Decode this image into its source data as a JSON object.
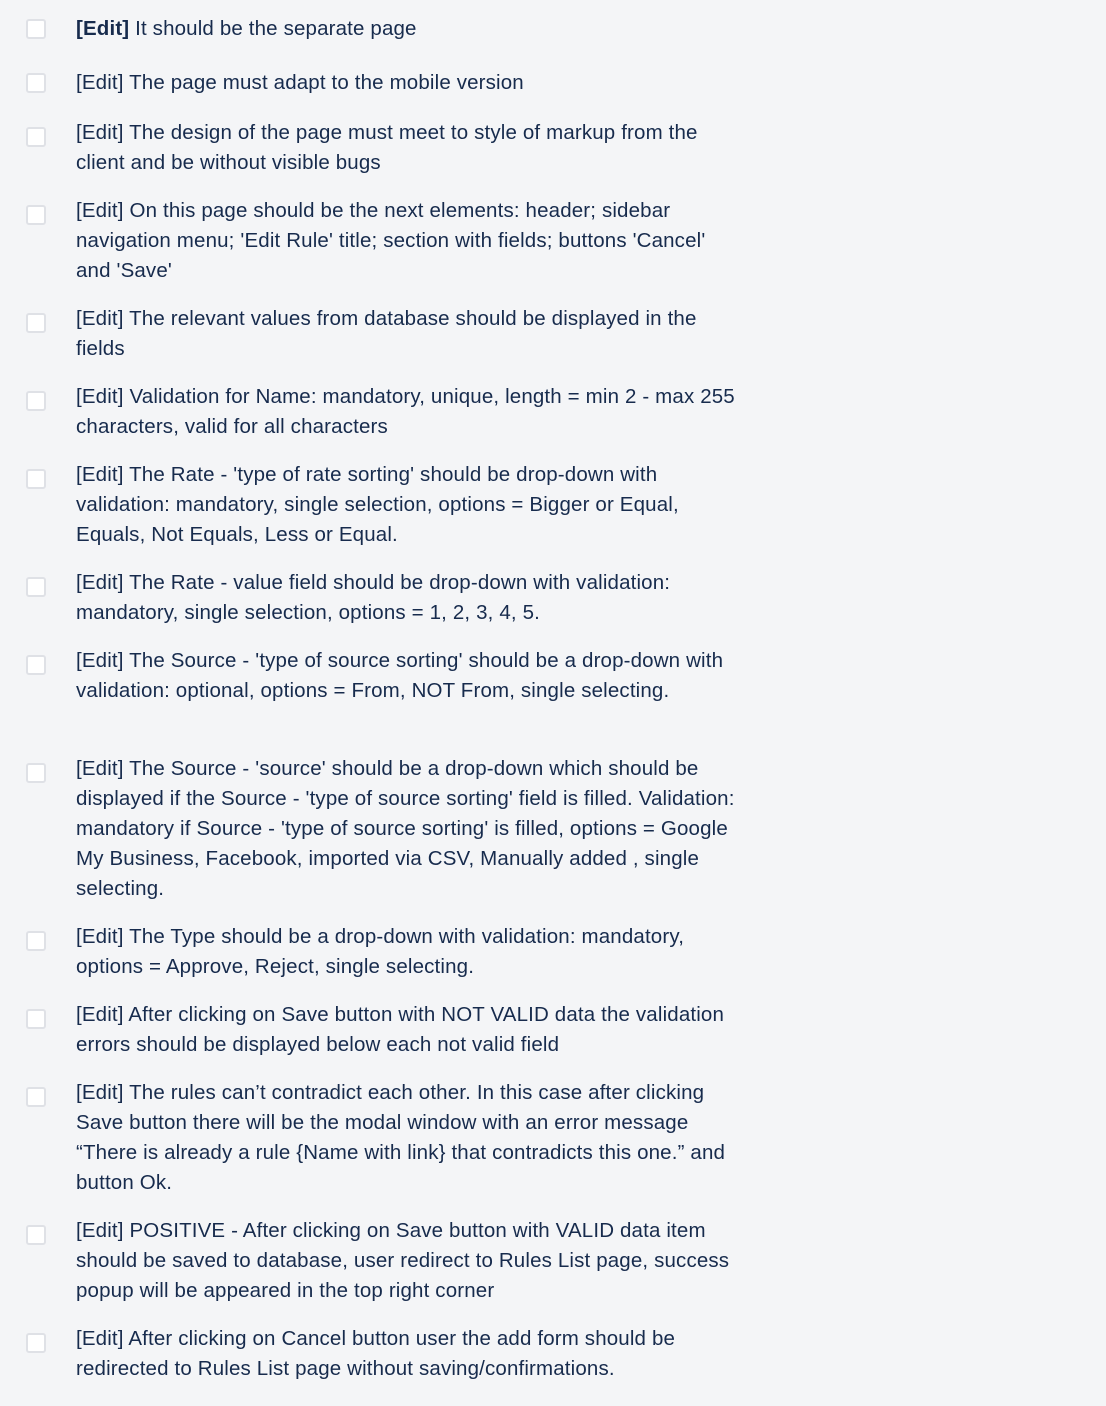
{
  "checklist": {
    "items": [
      {
        "prefix": "[Edit]",
        "text": "It should be the separate page",
        "checked": false
      },
      {
        "prefix": "[Edit]",
        "text": "The page must adapt to the mobile version",
        "checked": false
      },
      {
        "prefix": "[Edit]",
        "text": "The design of the page must meet to style of markup from the client and be without visible bugs",
        "checked": false
      },
      {
        "prefix": "[Edit]",
        "text": "On this page should be the next elements: header; sidebar navigation menu; 'Edit Rule' title; section with fields; buttons 'Cancel' and 'Save'",
        "checked": false
      },
      {
        "prefix": "[Edit]",
        "text": "The relevant values from database should be displayed in the fields",
        "checked": false
      },
      {
        "prefix": "[Edit]",
        "text": "Validation for Name: mandatory, unique, length = min 2 - max 255 characters, valid for all characters",
        "checked": false
      },
      {
        "prefix": "[Edit]",
        "text": "The Rate - 'type of rate sorting' should be drop-down with validation: mandatory, single selection, options = Bigger or Equal, Equals, Not Equals, Less or Equal.",
        "checked": false
      },
      {
        "prefix": "[Edit]",
        "text": "The Rate - value field should be drop-down with validation: mandatory, single selection, options = 1, 2, 3, 4, 5.",
        "checked": false
      },
      {
        "prefix": "[Edit]",
        "text": "The Source - 'type of source sorting' should be a drop-down with validation: optional, options = From, NOT From, single selecting.",
        "checked": false
      },
      {
        "prefix": "[Edit]",
        "text": "The Source - 'source' should be a drop-down which should be displayed if the Source - 'type of source sorting' field is filled. Validation: mandatory if Source - 'type of source sorting' is filled, options = Google My Business, Facebook, imported via CSV, Manually added , single selecting.",
        "checked": false
      },
      {
        "prefix": "[Edit]",
        "text": "The Type should be a drop-down with validation: mandatory, options = Approve, Reject, single selecting.",
        "checked": false
      },
      {
        "prefix": "[Edit]",
        "text": "After clicking on Save button with NOT VALID data the validation errors should be displayed below each not valid field",
        "checked": false
      },
      {
        "prefix": "[Edit]",
        "text": "The rules can’t contradict each other. In this case after clicking Save button there will be the modal window with an error message “There is already a rule {Name with link} that contradicts this one.” and button Ok.",
        "checked": false
      },
      {
        "prefix": "[Edit]",
        "text": "POSITIVE - After clicking on Save button with VALID data item should be saved to database, user redirect to Rules List page, success popup will be appeared in the top right corner",
        "checked": false
      },
      {
        "prefix": "[Edit]",
        "text": "After clicking on Cancel button user the add form should be redirected to Rules List page without saving/confirmations.",
        "checked": false
      }
    ]
  }
}
